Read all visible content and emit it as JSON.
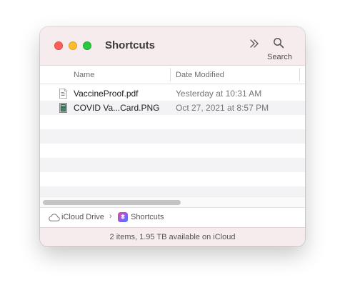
{
  "window": {
    "title": "Shortcuts"
  },
  "toolbar": {
    "more_icon": "chevron-double-right-icon",
    "search_icon": "magnifying-glass-icon",
    "search_label": "Search"
  },
  "columns": {
    "name": "Name",
    "date_modified": "Date Modified"
  },
  "files": [
    {
      "name": "VaccineProof.pdf",
      "date": "Yesterday at 10:31 AM",
      "icon": "pdf-document-icon"
    },
    {
      "name": "COVID Va...Card.PNG",
      "date": "Oct 27, 2021 at 8:57 PM",
      "icon": "png-image-icon"
    }
  ],
  "pathbar": {
    "root": "iCloud Drive",
    "separator": "›",
    "current": "Shortcuts"
  },
  "status": {
    "text": "2 items, 1.95 TB available on iCloud"
  },
  "colors": {
    "titlebar_bg": "#f7eced",
    "close": "#ff5f57",
    "minimize": "#febc2e",
    "zoom": "#28c840",
    "row_stripe": "#f3f3f5"
  }
}
